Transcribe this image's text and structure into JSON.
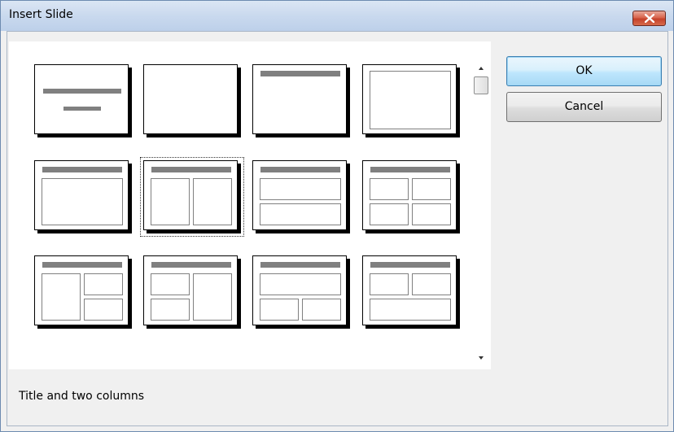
{
  "dialog": {
    "title": "Insert Slide",
    "ok_label": "OK",
    "cancel_label": "Cancel",
    "selected_layout_description": "Title and two columns"
  },
  "colors": {
    "titlebar": "#c9d9ee",
    "close_button": "#c5412a",
    "ok_button_accent": "#3c7fb1",
    "placeholder_gray": "#808080"
  },
  "layouts": [
    "title-slide",
    "blank",
    "title-only",
    "content-only",
    "title-and-content",
    "title-and-two-columns",
    "title-and-two-stacked",
    "title-and-four",
    "title-left-column-two-right",
    "title-two-left-column-right",
    "title-top-box-two-bottom",
    "title-two-top-bottom-box"
  ],
  "selected_layout_index": 5,
  "scrollbar": {
    "up_icon": "scroll-up-arrow-icon",
    "down_icon": "scroll-down-arrow-icon"
  }
}
